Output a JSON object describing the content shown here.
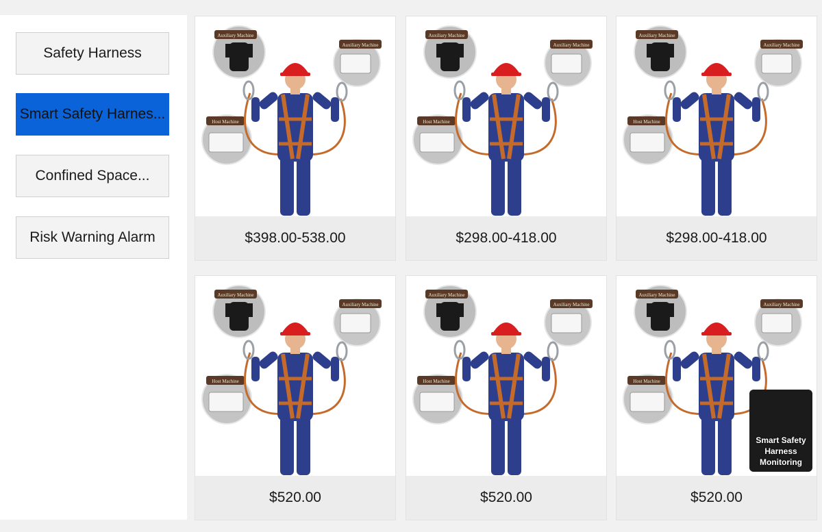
{
  "sidebar": {
    "categories": [
      {
        "label": "Safety Harness",
        "active": false
      },
      {
        "label": "Smart Safety Harnes...",
        "active": true
      },
      {
        "label": "Confined Space...",
        "active": false
      },
      {
        "label": "Risk Warning Alarm",
        "active": false
      }
    ]
  },
  "products": [
    {
      "price": "$398.00-538.00",
      "badges": {
        "aux_top": "Auxiliary Machine",
        "aux_right": "Auxiliary Machine",
        "host": "Host Machine"
      }
    },
    {
      "price": "$298.00-418.00",
      "badges": {
        "aux_top": "Auxiliary Machine",
        "aux_right": "Auxiliary Machine",
        "host": "Host Machine"
      }
    },
    {
      "price": "$298.00-418.00",
      "badges": {
        "aux_top": "Auxiliary Machine",
        "aux_right": "Auxiliary Machine",
        "host": "Host Machine"
      }
    },
    {
      "price": "$520.00",
      "badges": {
        "aux_top": "Auxiliary Machine",
        "aux_right": "Auxiliary Machine",
        "host": "Host Machine"
      }
    },
    {
      "price": "$520.00",
      "badges": {
        "aux_top": "Auxiliary Machine",
        "aux_right": "Auxiliary Machine",
        "host": "Host Machine"
      }
    },
    {
      "price": "$520.00",
      "badges": {
        "aux_top": "Auxiliary Machine",
        "aux_right": "Auxiliary Machine",
        "host": "Host Machine"
      },
      "overlay_text": "Smart Safety Harness Monitoring"
    }
  ],
  "colors": {
    "active_category": "#0a63d8",
    "price_bar": "#ececec",
    "helmet": "#d81e1e",
    "coverall": "#2d3f8c",
    "harness_strap": "#c46a2a",
    "badge_brown": "#5a3a26"
  }
}
